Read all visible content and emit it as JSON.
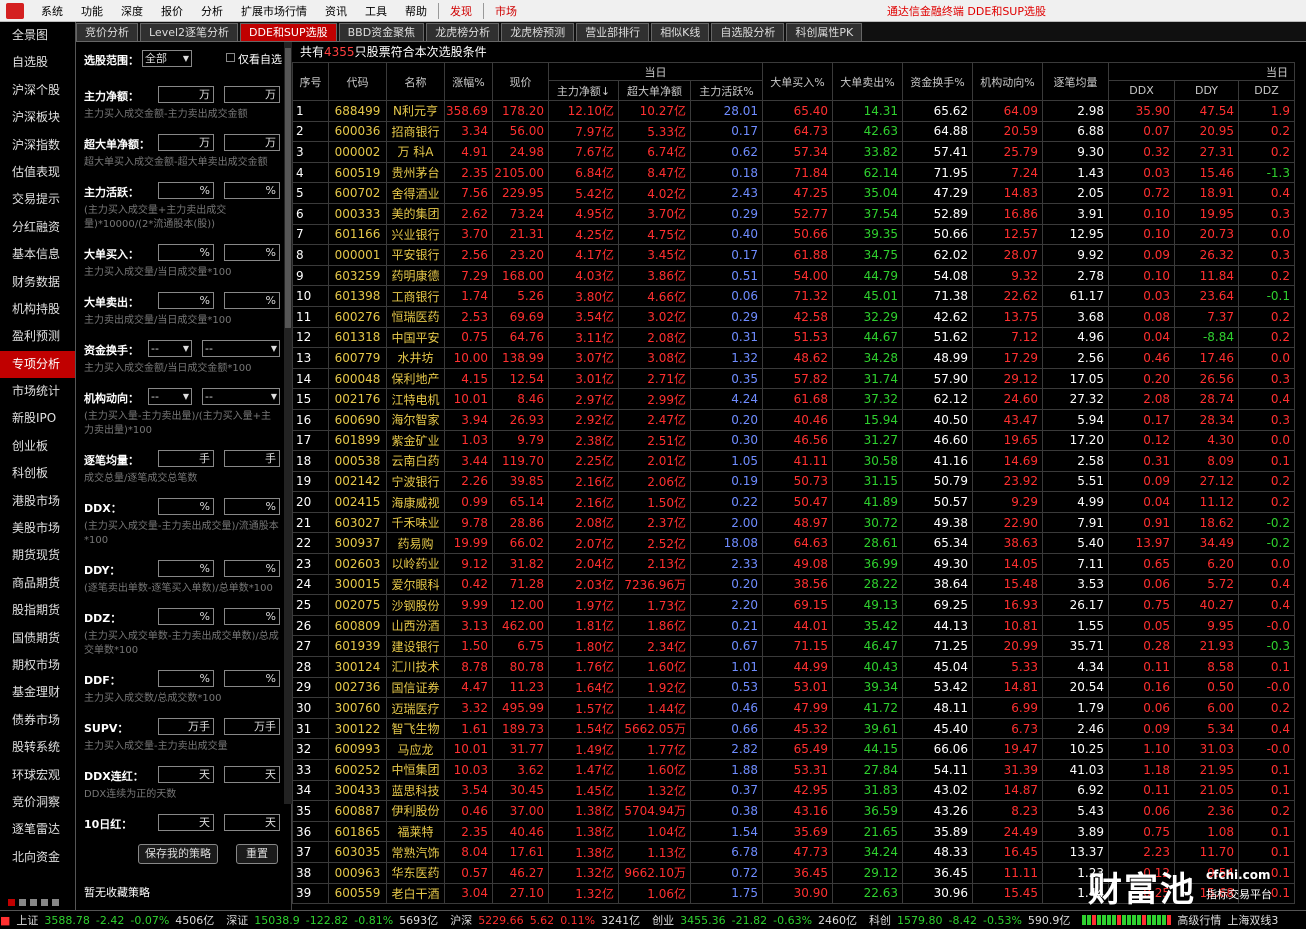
{
  "menu": {
    "items": [
      "系统",
      "功能",
      "深度",
      "报价",
      "分析",
      "扩展市场行情",
      "资讯",
      "工具",
      "帮助"
    ],
    "highlights": [
      "发现",
      "市场"
    ],
    "promo": "通达信金融终端 DDE和SUP选股"
  },
  "nav": {
    "items": [
      "全景图",
      "自选股",
      "沪深个股",
      "沪深板块",
      "沪深指数",
      "估值表现",
      "交易提示",
      "分红融资",
      "基本信息",
      "财务数据",
      "机构持股",
      "盈利预测",
      "专项分析",
      "市场统计",
      "新股IPO",
      "创业板",
      "科创板",
      "港股市场",
      "美股市场",
      "期货现货",
      "商品期货",
      "股指期货",
      "国债期货",
      "期权市场",
      "基金理财",
      "债券市场",
      "股转系统",
      "环球宏观",
      "竞价洞察",
      "逐笔雷达",
      "北向资金"
    ],
    "active_index": 12
  },
  "tabs": {
    "items": [
      "竞价分析",
      "Level2逐笔分析",
      "DDE和SUP选股",
      "BBD资金聚焦",
      "龙虎榜分析",
      "龙虎榜预测",
      "营业部排行",
      "相似K线",
      "自选股分析",
      "科创属性PK"
    ],
    "active_index": 2
  },
  "filter": {
    "scope_label": "选股范围：",
    "scope_value": "全部",
    "only_watchlist": "仅看自选",
    "rows": [
      {
        "label": "主力净额：",
        "u1": "万",
        "u2": "万",
        "hint": "主力买入成交金额-主力卖出成交金额"
      },
      {
        "label": "超大单净额：",
        "u1": "万",
        "u2": "万",
        "hint": "超大单买入成交金额-超大单卖出成交金额"
      },
      {
        "label": "主力活跃：",
        "u1": "%",
        "u2": "%",
        "hint": "(主力买入成交量+主力卖出成交量)*10000/(2*流通股本(股))"
      },
      {
        "label": "大单买入：",
        "u1": "%",
        "u2": "%",
        "hint": "主力买入成交量/当日成交量*100"
      },
      {
        "label": "大单卖出：",
        "u1": "%",
        "u2": "%",
        "hint": "主力卖出成交量/当日成交量*100"
      },
      {
        "label": "资金换手：",
        "u1": "--",
        "u2": "--",
        "hint": "主力买入成交金额/当日成交金额*100"
      },
      {
        "label": "机构动向：",
        "u1": "--",
        "u2": "--",
        "hint": "(主力买入量-主力卖出量)/(主力买入量+主力卖出量)*100"
      },
      {
        "label": "逐笔均量：",
        "u1": "手",
        "u2": "手",
        "hint": "成交总量/逐笔成交总笔数"
      },
      {
        "label": "DDX：",
        "u1": "%",
        "u2": "%",
        "hint": "(主力买入成交量-主力卖出成交量)/流通股本*100"
      },
      {
        "label": "DDY：",
        "u1": "%",
        "u2": "%",
        "hint": "(逐笔卖出单数-逐笔买入单数)/总单数*100"
      },
      {
        "label": "DDZ：",
        "u1": "%",
        "u2": "%",
        "hint": "(主力买入成交单数-主力卖出成交单数)/总成交单数*100"
      },
      {
        "label": "DDF：",
        "u1": "%",
        "u2": "%",
        "hint": "主力买入成交数/总成交数*100"
      },
      {
        "label": "SUPV：",
        "u1": "万手",
        "u2": "万手",
        "hint": "主力买入成交量-主力卖出成交量"
      },
      {
        "label": "DDX连红：",
        "u1": "天",
        "u2": "天",
        "hint": "DDX连续为正的天数"
      },
      {
        "label": "10日红：",
        "u1": "天",
        "u2": "天",
        "hint": ""
      }
    ],
    "save_btn": "保存我的策略",
    "reset_btn": "重置",
    "no_strategy": "暂无收藏策略"
  },
  "result": {
    "prefix": "共有",
    "count": "4355",
    "suffix": "只股票符合本次选股条件"
  },
  "table": {
    "group_today": "当日",
    "group_today2": "当日",
    "headers": [
      "序号",
      "代码",
      "名称",
      "涨幅%",
      "现价",
      "主力净额↓",
      "超大单净额",
      "主力活跃%",
      "大单买入%",
      "大单卖出%",
      "资金换手%",
      "机构动向%",
      "逐笔均量",
      "DDX",
      "DDY",
      "DDZ"
    ],
    "rows": [
      [
        "1",
        "688499",
        "N利元亨",
        "358.69",
        "178.20",
        "12.10亿",
        "10.27亿",
        "28.01",
        "65.40",
        "14.31",
        "65.62",
        "64.09",
        "2.98",
        "35.90",
        "47.54",
        "1.9"
      ],
      [
        "2",
        "600036",
        "招商银行",
        "3.34",
        "56.00",
        "7.97亿",
        "5.33亿",
        "0.17",
        "64.73",
        "42.63",
        "64.88",
        "20.59",
        "6.88",
        "0.07",
        "20.95",
        "0.2"
      ],
      [
        "3",
        "000002",
        "万 科A",
        "4.91",
        "24.98",
        "7.67亿",
        "6.74亿",
        "0.62",
        "57.34",
        "33.82",
        "57.41",
        "25.79",
        "9.30",
        "0.32",
        "27.31",
        "0.2"
      ],
      [
        "4",
        "600519",
        "贵州茅台",
        "2.35",
        "2105.00",
        "6.84亿",
        "8.47亿",
        "0.18",
        "71.84",
        "62.14",
        "71.95",
        "7.24",
        "1.43",
        "0.03",
        "15.46",
        "-1.3"
      ],
      [
        "5",
        "600702",
        "舍得酒业",
        "7.56",
        "229.95",
        "5.42亿",
        "4.02亿",
        "2.43",
        "47.25",
        "35.04",
        "47.29",
        "14.83",
        "2.05",
        "0.72",
        "18.91",
        "0.4"
      ],
      [
        "6",
        "000333",
        "美的集团",
        "2.62",
        "73.24",
        "4.95亿",
        "3.70亿",
        "0.29",
        "52.77",
        "37.54",
        "52.89",
        "16.86",
        "3.91",
        "0.10",
        "19.95",
        "0.3"
      ],
      [
        "7",
        "601166",
        "兴业银行",
        "3.70",
        "21.31",
        "4.25亿",
        "4.75亿",
        "0.40",
        "50.66",
        "39.35",
        "50.66",
        "12.57",
        "12.95",
        "0.10",
        "20.73",
        "0.0"
      ],
      [
        "8",
        "000001",
        "平安银行",
        "2.56",
        "23.20",
        "4.17亿",
        "3.45亿",
        "0.17",
        "61.88",
        "34.75",
        "62.02",
        "28.07",
        "9.92",
        "0.09",
        "26.32",
        "0.3"
      ],
      [
        "9",
        "603259",
        "药明康德",
        "7.29",
        "168.00",
        "4.03亿",
        "3.86亿",
        "0.51",
        "54.00",
        "44.79",
        "54.08",
        "9.32",
        "2.78",
        "0.10",
        "11.84",
        "0.2"
      ],
      [
        "10",
        "601398",
        "工商银行",
        "1.74",
        "5.26",
        "3.80亿",
        "4.66亿",
        "0.06",
        "71.32",
        "45.01",
        "71.38",
        "22.62",
        "61.17",
        "0.03",
        "23.64",
        "-0.1"
      ],
      [
        "11",
        "600276",
        "恒瑞医药",
        "2.53",
        "69.69",
        "3.54亿",
        "3.02亿",
        "0.29",
        "42.58",
        "32.29",
        "42.62",
        "13.75",
        "3.68",
        "0.08",
        "7.37",
        "0.2"
      ],
      [
        "12",
        "601318",
        "中国平安",
        "0.75",
        "64.76",
        "3.11亿",
        "2.08亿",
        "0.31",
        "51.53",
        "44.67",
        "51.62",
        "7.12",
        "4.96",
        "0.04",
        "-8.84",
        "0.2"
      ],
      [
        "13",
        "600779",
        "水井坊",
        "10.00",
        "138.99",
        "3.07亿",
        "3.08亿",
        "1.32",
        "48.62",
        "34.28",
        "48.99",
        "17.29",
        "2.56",
        "0.46",
        "17.46",
        "0.0"
      ],
      [
        "14",
        "600048",
        "保利地产",
        "4.15",
        "12.54",
        "3.01亿",
        "2.71亿",
        "0.35",
        "57.82",
        "31.74",
        "57.90",
        "29.12",
        "17.05",
        "0.20",
        "26.56",
        "0.3"
      ],
      [
        "15",
        "002176",
        "江特电机",
        "10.01",
        "8.46",
        "2.97亿",
        "2.99亿",
        "4.24",
        "61.68",
        "37.32",
        "62.12",
        "24.60",
        "27.32",
        "2.08",
        "28.74",
        "0.4"
      ],
      [
        "16",
        "600690",
        "海尔智家",
        "3.94",
        "26.93",
        "2.92亿",
        "2.47亿",
        "0.20",
        "40.46",
        "15.94",
        "40.50",
        "43.47",
        "5.94",
        "0.17",
        "28.34",
        "0.3"
      ],
      [
        "17",
        "601899",
        "紫金矿业",
        "1.03",
        "9.79",
        "2.38亿",
        "2.51亿",
        "0.30",
        "46.56",
        "31.27",
        "46.60",
        "19.65",
        "17.20",
        "0.12",
        "4.30",
        "0.0"
      ],
      [
        "18",
        "000538",
        "云南白药",
        "3.44",
        "119.70",
        "2.25亿",
        "2.01亿",
        "1.05",
        "41.11",
        "30.58",
        "41.16",
        "14.69",
        "2.58",
        "0.31",
        "8.09",
        "0.1"
      ],
      [
        "19",
        "002142",
        "宁波银行",
        "2.26",
        "39.85",
        "2.16亿",
        "2.06亿",
        "0.19",
        "50.73",
        "31.15",
        "50.79",
        "23.92",
        "5.51",
        "0.09",
        "27.12",
        "0.2"
      ],
      [
        "20",
        "002415",
        "海康威视",
        "0.99",
        "65.14",
        "2.16亿",
        "1.50亿",
        "0.22",
        "50.47",
        "41.89",
        "50.57",
        "9.29",
        "4.99",
        "0.04",
        "11.12",
        "0.2"
      ],
      [
        "21",
        "603027",
        "千禾味业",
        "9.78",
        "28.86",
        "2.08亿",
        "2.37亿",
        "2.00",
        "48.97",
        "30.72",
        "49.38",
        "22.90",
        "7.91",
        "0.91",
        "18.62",
        "-0.2"
      ],
      [
        "22",
        "300937",
        "药易购",
        "19.99",
        "66.02",
        "2.07亿",
        "2.52亿",
        "18.08",
        "64.63",
        "28.61",
        "65.34",
        "38.63",
        "5.40",
        "13.97",
        "34.49",
        "-0.2"
      ],
      [
        "23",
        "002603",
        "以岭药业",
        "9.12",
        "31.82",
        "2.04亿",
        "2.13亿",
        "2.33",
        "49.08",
        "36.99",
        "49.30",
        "14.05",
        "7.11",
        "0.65",
        "6.20",
        "0.0"
      ],
      [
        "24",
        "300015",
        "爱尔眼科",
        "0.42",
        "71.28",
        "2.03亿",
        "7236.96万",
        "0.20",
        "38.56",
        "28.22",
        "38.64",
        "15.48",
        "3.53",
        "0.06",
        "5.72",
        "0.4"
      ],
      [
        "25",
        "002075",
        "沙钢股份",
        "9.99",
        "12.00",
        "1.97亿",
        "1.73亿",
        "2.20",
        "69.15",
        "49.13",
        "69.25",
        "16.93",
        "26.17",
        "0.75",
        "40.27",
        "0.4"
      ],
      [
        "26",
        "600809",
        "山西汾酒",
        "3.13",
        "462.00",
        "1.81亿",
        "1.86亿",
        "0.21",
        "44.01",
        "35.42",
        "44.13",
        "10.81",
        "1.55",
        "0.05",
        "9.95",
        "-0.0"
      ],
      [
        "27",
        "601939",
        "建设银行",
        "1.50",
        "6.75",
        "1.80亿",
        "2.34亿",
        "0.67",
        "71.15",
        "46.47",
        "71.25",
        "20.99",
        "35.71",
        "0.28",
        "21.93",
        "-0.3"
      ],
      [
        "28",
        "300124",
        "汇川技术",
        "8.78",
        "80.78",
        "1.76亿",
        "1.60亿",
        "1.01",
        "44.99",
        "40.43",
        "45.04",
        "5.33",
        "4.34",
        "0.11",
        "8.58",
        "0.1"
      ],
      [
        "29",
        "002736",
        "国信证券",
        "4.47",
        "11.23",
        "1.64亿",
        "1.92亿",
        "0.53",
        "53.01",
        "39.34",
        "53.42",
        "14.81",
        "20.54",
        "0.16",
        "0.50",
        "-0.0"
      ],
      [
        "30",
        "300760",
        "迈瑞医疗",
        "3.32",
        "495.99",
        "1.57亿",
        "1.44亿",
        "0.46",
        "47.99",
        "41.72",
        "48.11",
        "6.99",
        "1.79",
        "0.06",
        "6.00",
        "0.2"
      ],
      [
        "31",
        "300122",
        "智飞生物",
        "1.61",
        "189.73",
        "1.54亿",
        "5662.05万",
        "0.66",
        "45.32",
        "39.61",
        "45.40",
        "6.73",
        "2.46",
        "0.09",
        "5.34",
        "0.4"
      ],
      [
        "32",
        "600993",
        "马应龙",
        "10.01",
        "31.77",
        "1.49亿",
        "1.77亿",
        "2.82",
        "65.49",
        "44.15",
        "66.06",
        "19.47",
        "10.25",
        "1.10",
        "31.03",
        "-0.0"
      ],
      [
        "33",
        "600252",
        "中恒集团",
        "10.03",
        "3.62",
        "1.47亿",
        "1.60亿",
        "1.88",
        "53.31",
        "27.84",
        "54.11",
        "31.39",
        "41.03",
        "1.18",
        "21.95",
        "0.1"
      ],
      [
        "34",
        "300433",
        "蓝思科技",
        "3.54",
        "30.45",
        "1.45亿",
        "1.32亿",
        "0.37",
        "42.95",
        "31.83",
        "43.02",
        "14.87",
        "6.92",
        "0.11",
        "21.05",
        "0.1"
      ],
      [
        "35",
        "600887",
        "伊利股份",
        "0.46",
        "37.00",
        "1.38亿",
        "5704.94万",
        "0.38",
        "43.16",
        "36.59",
        "43.26",
        "8.23",
        "5.43",
        "0.06",
        "2.36",
        "0.2"
      ],
      [
        "36",
        "601865",
        "福莱特",
        "2.35",
        "40.46",
        "1.38亿",
        "1.04亿",
        "1.54",
        "35.69",
        "21.65",
        "35.89",
        "24.49",
        "3.89",
        "0.75",
        "1.08",
        "0.1"
      ],
      [
        "37",
        "603035",
        "常熟汽饰",
        "8.04",
        "17.61",
        "1.38亿",
        "1.13亿",
        "6.78",
        "47.73",
        "34.24",
        "48.33",
        "16.45",
        "13.37",
        "2.23",
        "11.70",
        "0.1"
      ],
      [
        "38",
        "000963",
        "华东医药",
        "0.57",
        "46.27",
        "1.32亿",
        "9662.10万",
        "0.72",
        "36.45",
        "29.12",
        "36.45",
        "11.11",
        "1.23",
        "0.12",
        "9.54",
        "0.1"
      ],
      [
        "39",
        "600559",
        "老白干酒",
        "3.04",
        "27.10",
        "1.32亿",
        "1.06亿",
        "1.75",
        "30.90",
        "22.63",
        "30.96",
        "15.45",
        "1.44",
        "0.25",
        "15.68",
        "0.1"
      ]
    ]
  },
  "status": {
    "sh": {
      "label": "上证",
      "value": "3588.78",
      "chg": "-2.42",
      "pct": "-0.07%",
      "amt": "4506亿"
    },
    "sz": {
      "label": "深证",
      "value": "15038.9",
      "chg": "-122.82",
      "pct": "-0.81%",
      "amt": "5693亿"
    },
    "hs": {
      "label": "沪深",
      "value": "5229.66",
      "chg": "5.62",
      "pct": "0.11%",
      "amt": "3241亿"
    },
    "cy": {
      "label": "创业",
      "value": "3455.36",
      "chg": "-21.82",
      "pct": "-0.63%",
      "amt": "2460亿"
    },
    "kc": {
      "label": "科创",
      "value": "1579.80",
      "chg": "-8.42",
      "pct": "-0.53%",
      "amt": "590.9亿"
    },
    "extra1": "高级行情",
    "extra2": "上海双线3"
  },
  "watermark": {
    "big": "财富池",
    "url": "cfchi.com",
    "sub": "指标交易平台"
  },
  "colors": {
    "up": "#ff3030",
    "down": "#2fd12f",
    "accent": "#c00000",
    "code": "#e6c84a",
    "blue": "#6f8cff"
  }
}
